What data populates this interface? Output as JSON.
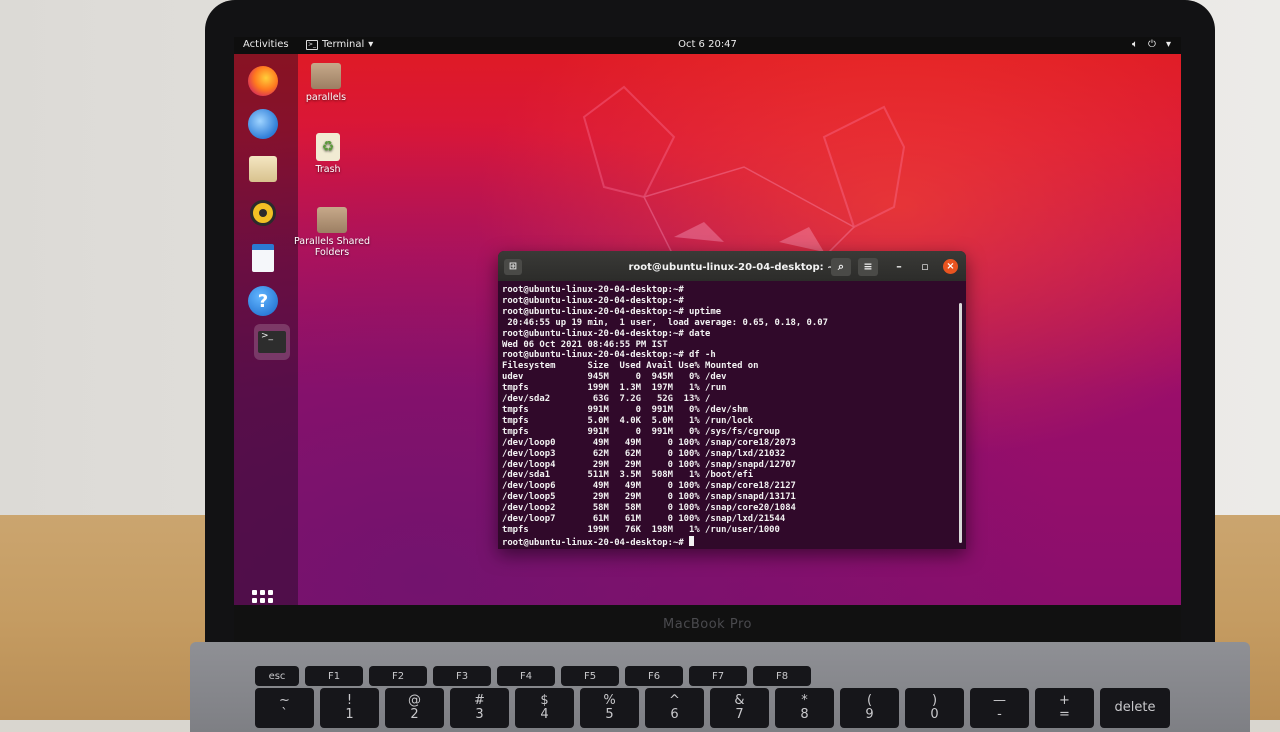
{
  "topbar": {
    "activities": "Activities",
    "app_name": "Terminal",
    "clock": "Oct 6  20:47"
  },
  "dock": {
    "items": [
      "firefox-icon",
      "thunderbird-icon",
      "files-icon",
      "rhythmbox-icon",
      "libreoffice-writer-icon",
      "help-icon",
      "terminal-icon"
    ]
  },
  "desktop": {
    "icons": [
      {
        "label": "parallels"
      },
      {
        "label": "Trash"
      },
      {
        "label": "Parallels Shared Folders"
      }
    ]
  },
  "terminal": {
    "title": "root@ubuntu-linux-20-04-desktop: ~",
    "lines": [
      "root@ubuntu-linux-20-04-desktop:~#",
      "root@ubuntu-linux-20-04-desktop:~#",
      "root@ubuntu-linux-20-04-desktop:~# uptime",
      " 20:46:55 up 19 min,  1 user,  load average: 0.65, 0.18, 0.07",
      "root@ubuntu-linux-20-04-desktop:~# date",
      "Wed 06 Oct 2021 08:46:55 PM IST",
      "root@ubuntu-linux-20-04-desktop:~# df -h",
      "Filesystem      Size  Used Avail Use% Mounted on",
      "udev            945M     0  945M   0% /dev",
      "tmpfs           199M  1.3M  197M   1% /run",
      "/dev/sda2        63G  7.2G   52G  13% /",
      "tmpfs           991M     0  991M   0% /dev/shm",
      "tmpfs           5.0M  4.0K  5.0M   1% /run/lock",
      "tmpfs           991M     0  991M   0% /sys/fs/cgroup",
      "/dev/loop0       49M   49M     0 100% /snap/core18/2073",
      "/dev/loop3       62M   62M     0 100% /snap/lxd/21032",
      "/dev/loop4       29M   29M     0 100% /snap/snapd/12707",
      "/dev/sda1       511M  3.5M  508M   1% /boot/efi",
      "/dev/loop6       49M   49M     0 100% /snap/core18/2127",
      "/dev/loop5       29M   29M     0 100% /snap/snapd/13171",
      "/dev/loop2       58M   58M     0 100% /snap/core20/1084",
      "/dev/loop7       61M   61M     0 100% /snap/lxd/21544",
      "tmpfs           199M   76K  198M   1% /run/user/1000"
    ],
    "prompt": "root@ubuntu-linux-20-04-desktop:~# "
  },
  "laptop": {
    "brand": "MacBook Pro"
  },
  "keyboard": {
    "fn_row": [
      "esc",
      "F1",
      "F2",
      "F3",
      "F4",
      "F5",
      "F6",
      "F7",
      "F8"
    ],
    "num_row": [
      {
        "top": "~",
        "bottom": "`"
      },
      {
        "top": "!",
        "bottom": "1"
      },
      {
        "top": "@",
        "bottom": "2"
      },
      {
        "top": "#",
        "bottom": "3"
      },
      {
        "top": "$",
        "bottom": "4"
      },
      {
        "top": "%",
        "bottom": "5"
      },
      {
        "top": "^",
        "bottom": "6"
      },
      {
        "top": "&",
        "bottom": "7"
      },
      {
        "top": "*",
        "bottom": "8"
      },
      {
        "top": "(",
        "bottom": "9"
      },
      {
        "top": ")",
        "bottom": "0"
      },
      {
        "top": "—",
        "bottom": "-"
      },
      {
        "top": "+",
        "bottom": "="
      }
    ],
    "delete": "delete"
  },
  "colors": {
    "ubuntu_orange": "#e95420",
    "terminal_bg": "#30092a"
  }
}
